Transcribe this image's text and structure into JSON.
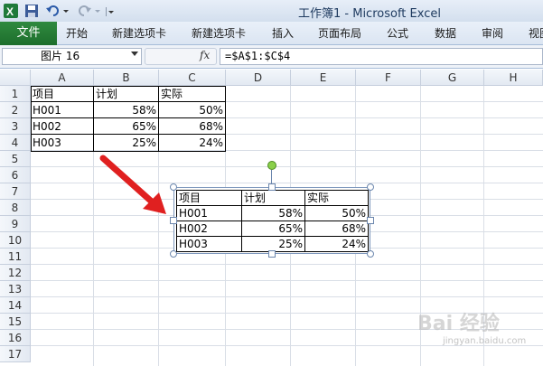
{
  "window": {
    "title": "工作簿1 - Microsoft Excel"
  },
  "ribbon": {
    "file_tab": "文件",
    "tabs": [
      "开始",
      "新建选项卡",
      "新建选项卡",
      "插入",
      "页面布局",
      "公式",
      "数据",
      "审阅",
      "视图"
    ]
  },
  "formula_bar": {
    "name_box": "图片 16",
    "fx_label": "fx",
    "formula": "=$A$1:$C$4"
  },
  "sheet": {
    "columns": [
      "A",
      "B",
      "C",
      "D",
      "E",
      "F",
      "G",
      "H"
    ],
    "rows": [
      "1",
      "2",
      "3",
      "4",
      "5",
      "6",
      "7",
      "8",
      "9",
      "10",
      "11",
      "12",
      "13",
      "14",
      "15",
      "16",
      "17"
    ],
    "cells": {
      "A1": "项目",
      "B1": "计划",
      "C1": "实际",
      "A2": "H001",
      "B2": "58%",
      "C2": "50%",
      "A3": "H002",
      "B3": "65%",
      "C3": "68%",
      "A4": "H003",
      "B4": "25%",
      "C4": "24%"
    }
  },
  "picture": {
    "rows": [
      [
        "项目",
        "计划",
        "实际"
      ],
      [
        "H001",
        "58%",
        "50%"
      ],
      [
        "H002",
        "65%",
        "68%"
      ],
      [
        "H003",
        "25%",
        "24%"
      ]
    ]
  },
  "colors": {
    "file_tab": "#1d6e2c",
    "arrow": "#e02020",
    "rotate_handle": "#8ad04a"
  },
  "watermark": {
    "main": "Bai 经验",
    "sub": "jingyan.baidu.com"
  }
}
